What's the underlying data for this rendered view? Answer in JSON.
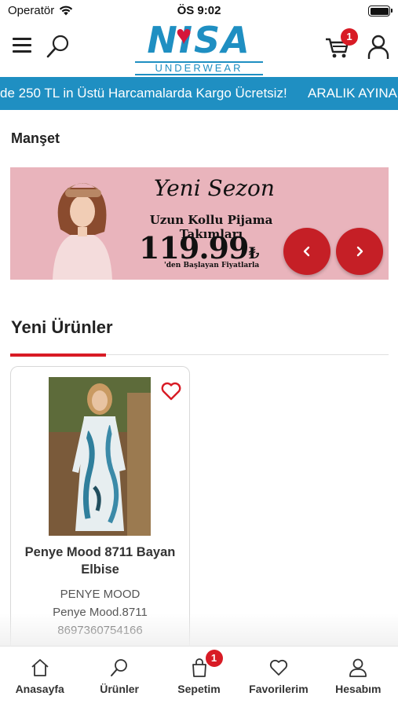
{
  "status_bar": {
    "carrier": "Operatör",
    "time": "ÖS 9:02"
  },
  "header": {
    "logo_text": "NISA",
    "logo_subtitle": "UNDERWEAR",
    "cart_count": "1",
    "icons": {
      "menu": "hamburger-icon",
      "search": "search-icon",
      "cart": "cart-icon",
      "account": "person-icon"
    }
  },
  "marquee": {
    "items": [
      "de 250 TL in Üstü Harcamalarda Kargo Ücretsiz!",
      "ARALIK AYINA"
    ]
  },
  "manset": {
    "title": "Manşet",
    "banner": {
      "headline": "Yeni Sezon",
      "subtitle": "Uzun Kollu Pijama Takımları",
      "price": "119.99",
      "currency": "₺",
      "note": "'den Başlayan Fiyatlarla",
      "background": "#e9b4bc"
    }
  },
  "new_products": {
    "title": "Yeni Ürünler",
    "accent_color": "#d81b25",
    "items": [
      {
        "name": "Penye Mood 8711 Bayan Elbise",
        "brand": "PENYE MOOD",
        "code": "Penye Mood.8711",
        "barcode": "8697360754166"
      }
    ]
  },
  "bottom_nav": {
    "items": [
      {
        "label": "Anasayfa",
        "icon": "home-icon"
      },
      {
        "label": "Ürünler",
        "icon": "search-icon"
      },
      {
        "label": "Sepetim",
        "icon": "bag-icon",
        "badge": "1"
      },
      {
        "label": "Favorilerim",
        "icon": "heart-icon"
      },
      {
        "label": "Hesabım",
        "icon": "person-icon"
      }
    ]
  },
  "colors": {
    "brand_blue": "#1f8fc2",
    "brand_red": "#d81b25",
    "slider_red": "#c51f26"
  }
}
